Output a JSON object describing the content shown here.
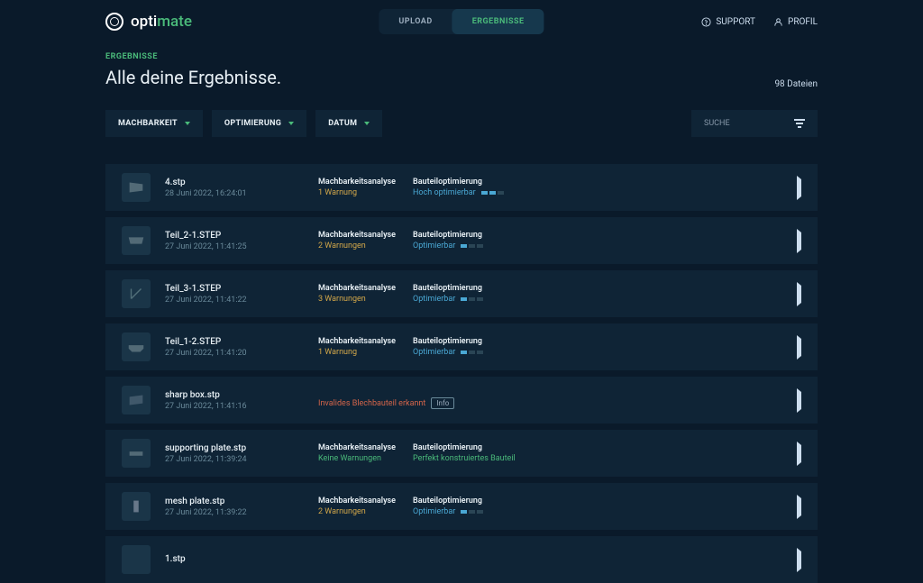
{
  "brand": {
    "opti": "opti",
    "mate": "mate"
  },
  "nav": {
    "upload": "UPLOAD",
    "results": "ERGEBNISSE"
  },
  "header": {
    "support": "SUPPORT",
    "profile": "PROFIL"
  },
  "section_label": "ERGEBNISSE",
  "page_title": "Alle deine Ergebnisse.",
  "file_count": "98 Dateien",
  "filters": {
    "machbarkeit": "MACHBARKEIT",
    "optimierung": "OPTIMIERUNG",
    "datum": "DATUM"
  },
  "search_placeholder": "SUCHE",
  "col_labels": {
    "analysis": "Machbarkeitsanalyse",
    "optim": "Bauteiloptimierung"
  },
  "invalid": {
    "msg": "Invalides Blechbauteil erkannt",
    "info": "Info"
  },
  "rows": [
    {
      "name": "4.stp",
      "date": "28 Juni 2022, 16:24:01",
      "warn": "1 Warnung",
      "warn_cls": "warn-1",
      "opt": "Hoch optimierbar",
      "opt_cls": "opt-high",
      "bars": 2,
      "type": "part"
    },
    {
      "name": "Teil_2-1.STEP",
      "date": "27 Juni 2022, 11:41:25",
      "warn": "2 Warnungen",
      "warn_cls": "warn-1",
      "opt": "Optimierbar",
      "opt_cls": "opt-mid",
      "bars": 1,
      "type": "part"
    },
    {
      "name": "Teil_3-1.STEP",
      "date": "27 Juni 2022, 11:41:22",
      "warn": "3 Warnungen",
      "warn_cls": "warn-1",
      "opt": "Optimierbar",
      "opt_cls": "opt-mid",
      "bars": 1,
      "type": "part"
    },
    {
      "name": "Teil_1-2.STEP",
      "date": "27 Juni 2022, 11:41:20",
      "warn": "1 Warnung",
      "warn_cls": "warn-1",
      "opt": "Optimierbar",
      "opt_cls": "opt-mid",
      "bars": 1,
      "type": "part"
    },
    {
      "name": "sharp box.stp",
      "date": "27 Juni 2022, 11:41:16",
      "type": "invalid"
    },
    {
      "name": "supporting plate.stp",
      "date": "27 Juni 2022, 11:39:24",
      "warn": "Keine Warnungen",
      "warn_cls": "warn-0",
      "opt": "Perfekt konstruiertes Bauteil",
      "opt_cls": "opt-perfect",
      "bars": 0,
      "type": "part"
    },
    {
      "name": "mesh plate.stp",
      "date": "27 Juni 2022, 11:39:22",
      "warn": "2 Warnungen",
      "warn_cls": "warn-1",
      "opt": "Optimierbar",
      "opt_cls": "opt-mid",
      "bars": 1,
      "type": "part"
    },
    {
      "name": "1.stp",
      "date": "",
      "type": "cut"
    }
  ]
}
